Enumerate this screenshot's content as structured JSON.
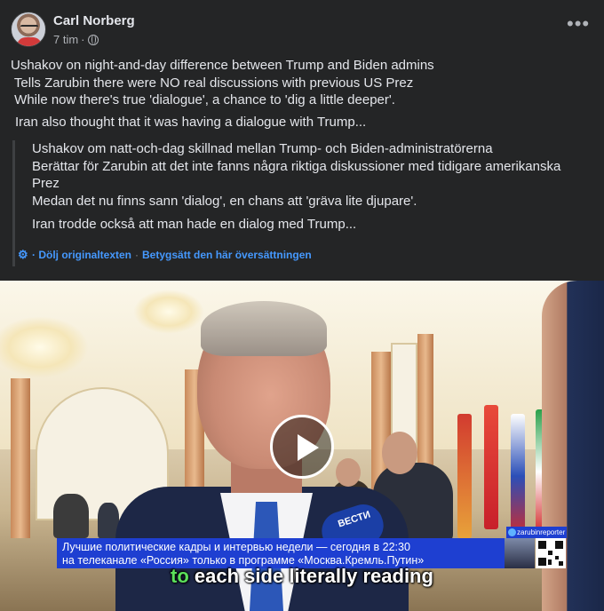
{
  "post": {
    "author": "Carl Norberg",
    "time": "7 tim",
    "separator": "·",
    "privacy_icon": "globe-icon",
    "more_icon": "more-horizontal-icon",
    "text_lines": [
      "Ushakov on night-and-day difference between Trump and Biden admins",
      " Tells Zarubin there were NO real discussions with previous US Prez",
      " While now there's true 'dialogue', a chance to 'dig a little deeper'."
    ],
    "text_paragraph2": "Iran also thought that it was having a dialogue with Trump..."
  },
  "translation": {
    "lines": [
      "Ushakov om natt-och-dag skillnad mellan Trump- och Biden-administratörerna",
      "Berättar för Zarubin att det inte fanns några riktiga diskussioner med tidigare amerikanska",
      "Prez",
      "Medan det nu finns sann 'dialog', en chans att 'gräva lite djupare'."
    ],
    "paragraph2": "Iran trodde också att man hade en dialog med Trump...",
    "hide_original_label": "· Dölj originaltexten",
    "separator": "·",
    "rate_label": "Betygsätt den här översättningen",
    "icon": "gear-icon"
  },
  "video": {
    "play_icon": "play-icon",
    "channel_tag": "zarubinreporter",
    "mic_logo": "ВЕСТИ",
    "banner_line1": "Лучшие политические кадры и интервью недели — сегодня в 22:30",
    "banner_line2": "на телеканале «Россия» только в программе «Москва.Кремль.Путин»",
    "subtitle_highlight": "to",
    "subtitle_rest": " each side literally reading"
  },
  "colors": {
    "background": "#242526",
    "text": "#e4e6eb",
    "muted": "#b0b3b8",
    "link": "#4599ff",
    "banner": "#1e3fd1",
    "subtitle_highlight": "#5be05b"
  }
}
